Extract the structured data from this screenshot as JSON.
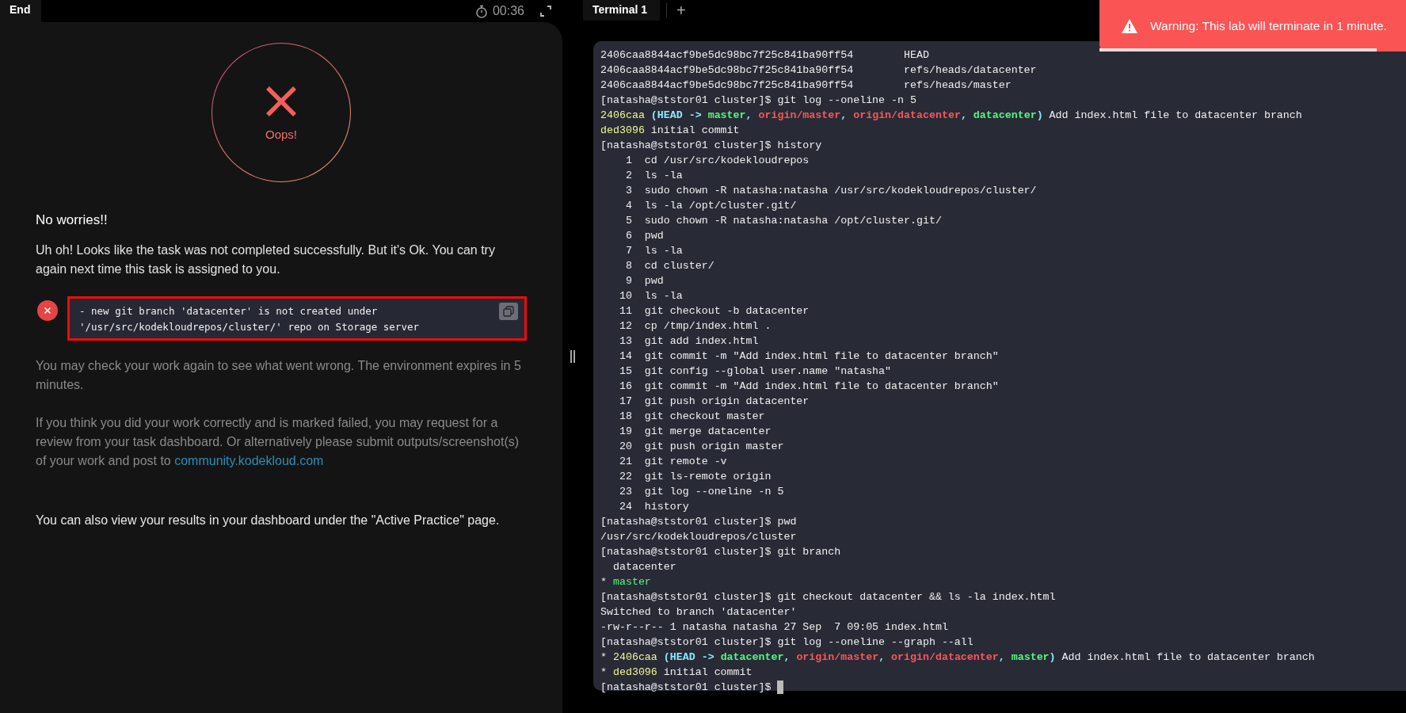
{
  "header": {
    "end_tab": "End",
    "timer": "00:36"
  },
  "result": {
    "status": "Oops!",
    "heading": "No worries!!",
    "message": "Uh oh! Looks like the task was not completed successfully. But it's Ok. You can try again next time this task is assigned to you.",
    "errors": [
      "- new git branch 'datacenter' is not created under '/usr/src/kodekloudrepos/cluster/' repo on Storage server"
    ],
    "check_again": "You may check your work again to see what went wrong. The environment expires in 5 minutes.",
    "review_text": "If you think you did your work correctly and is marked failed, you may request for a review from your task dashboard. Or alternatively please submit outputs/screenshot(s) of your work and post to",
    "review_link": "community.kodekloud.com",
    "dashboard_note": "You can also view your results in your dashboard under the \"Active Practice\" page."
  },
  "terminal_tabs": [
    {
      "label": "Terminal 1",
      "selected": true
    }
  ],
  "new_tab": "+",
  "toast": {
    "message": "Warning: This lab will terminate in 1 minute.",
    "level": 0.86
  },
  "terminal_lines": [
    [
      {
        "kind": "plain",
        "text": "2406caa8844acf9be5dc98bc7f25c841ba90ff54        HEAD"
      }
    ],
    [
      {
        "kind": "plain",
        "text": "2406caa8844acf9be5dc98bc7f25c841ba90ff54        refs/heads/datacenter"
      }
    ],
    [
      {
        "kind": "plain",
        "text": "2406caa8844acf9be5dc98bc7f25c841ba90ff54        refs/heads/master"
      }
    ],
    [
      {
        "kind": "plain",
        "text": "[natasha@ststor01 cluster]$ git log --oneline -n 5"
      }
    ],
    [
      {
        "kind": "hash",
        "text": "2406caa"
      },
      {
        "kind": "head",
        "text": " (HEAD -> "
      },
      {
        "kind": "local",
        "text": "master"
      },
      {
        "kind": "head",
        "text": ", "
      },
      {
        "kind": "remote",
        "text": "origin/master"
      },
      {
        "kind": "head",
        "text": ", "
      },
      {
        "kind": "remote",
        "text": "origin/datacenter"
      },
      {
        "kind": "head",
        "text": ", "
      },
      {
        "kind": "local",
        "text": "datacenter"
      },
      {
        "kind": "head",
        "text": ")"
      },
      {
        "kind": "plain",
        "text": " Add index.html file to datacenter branch"
      }
    ],
    [
      {
        "kind": "hash",
        "text": "ded3096"
      },
      {
        "kind": "plain",
        "text": " initial commit"
      }
    ],
    [
      {
        "kind": "plain",
        "text": "[natasha@ststor01 cluster]$ history"
      }
    ],
    [
      {
        "kind": "plain",
        "text": "    1  cd /usr/src/kodekloudrepos"
      }
    ],
    [
      {
        "kind": "plain",
        "text": "    2  ls -la"
      }
    ],
    [
      {
        "kind": "plain",
        "text": "    3  sudo chown -R natasha:natasha /usr/src/kodekloudrepos/cluster/"
      }
    ],
    [
      {
        "kind": "plain",
        "text": "    4  ls -la /opt/cluster.git/"
      }
    ],
    [
      {
        "kind": "plain",
        "text": "    5  sudo chown -R natasha:natasha /opt/cluster.git/"
      }
    ],
    [
      {
        "kind": "plain",
        "text": "    6  pwd"
      }
    ],
    [
      {
        "kind": "plain",
        "text": "    7  ls -la"
      }
    ],
    [
      {
        "kind": "plain",
        "text": "    8  cd cluster/"
      }
    ],
    [
      {
        "kind": "plain",
        "text": "    9  pwd"
      }
    ],
    [
      {
        "kind": "plain",
        "text": "   10  ls -la"
      }
    ],
    [
      {
        "kind": "plain",
        "text": "   11  git checkout -b datacenter"
      }
    ],
    [
      {
        "kind": "plain",
        "text": "   12  cp /tmp/index.html ."
      }
    ],
    [
      {
        "kind": "plain",
        "text": "   13  git add index.html"
      }
    ],
    [
      {
        "kind": "plain",
        "text": "   14  git commit -m \"Add index.html file to datacenter branch\""
      }
    ],
    [
      {
        "kind": "plain",
        "text": "   15  git config --global user.name \"natasha\""
      }
    ],
    [
      {
        "kind": "plain",
        "text": "   16  git commit -m \"Add index.html file to datacenter branch\""
      }
    ],
    [
      {
        "kind": "plain",
        "text": "   17  git push origin datacenter"
      }
    ],
    [
      {
        "kind": "plain",
        "text": "   18  git checkout master"
      }
    ],
    [
      {
        "kind": "plain",
        "text": "   19  git merge datacenter"
      }
    ],
    [
      {
        "kind": "plain",
        "text": "   20  git push origin master"
      }
    ],
    [
      {
        "kind": "plain",
        "text": "   21  git remote -v"
      }
    ],
    [
      {
        "kind": "plain",
        "text": "   22  git ls-remote origin"
      }
    ],
    [
      {
        "kind": "plain",
        "text": "   23  git log --oneline -n 5"
      }
    ],
    [
      {
        "kind": "plain",
        "text": "   24  history"
      }
    ],
    [
      {
        "kind": "plain",
        "text": "[natasha@ststor01 cluster]$ pwd"
      }
    ],
    [
      {
        "kind": "plain",
        "text": "/usr/src/kodekloudrepos/cluster"
      }
    ],
    [
      {
        "kind": "plain",
        "text": "[natasha@ststor01 cluster]$ git branch"
      }
    ],
    [
      {
        "kind": "plain",
        "text": "  datacenter"
      }
    ],
    [
      {
        "kind": "plain",
        "text": "* "
      },
      {
        "kind": "local_thin",
        "text": "master"
      }
    ],
    [
      {
        "kind": "plain",
        "text": "[natasha@ststor01 cluster]$ git checkout datacenter && ls -la index.html"
      }
    ],
    [
      {
        "kind": "plain",
        "text": "Switched to branch 'datacenter'"
      }
    ],
    [
      {
        "kind": "plain",
        "text": "-rw-r--r-- 1 natasha natasha 27 Sep  7 09:05 index.html"
      }
    ],
    [
      {
        "kind": "plain",
        "text": "[natasha@ststor01 cluster]$ git log --oneline --graph --all"
      }
    ],
    [
      {
        "kind": "plain",
        "text": "* "
      },
      {
        "kind": "hash",
        "text": "2406caa"
      },
      {
        "kind": "head",
        "text": " (HEAD -> "
      },
      {
        "kind": "local",
        "text": "datacenter"
      },
      {
        "kind": "head",
        "text": ", "
      },
      {
        "kind": "remote",
        "text": "origin/master"
      },
      {
        "kind": "head",
        "text": ", "
      },
      {
        "kind": "remote",
        "text": "origin/datacenter"
      },
      {
        "kind": "head",
        "text": ", "
      },
      {
        "kind": "local",
        "text": "master"
      },
      {
        "kind": "head",
        "text": ")"
      },
      {
        "kind": "plain",
        "text": " Add index.html file to datacenter branch"
      }
    ],
    [
      {
        "kind": "plain",
        "text": "* "
      },
      {
        "kind": "hash",
        "text": "ded3096"
      },
      {
        "kind": "plain",
        "text": " initial commit"
      }
    ],
    [
      {
        "kind": "plain",
        "text": "[natasha@ststor01 cluster]$ "
      }
    ]
  ]
}
